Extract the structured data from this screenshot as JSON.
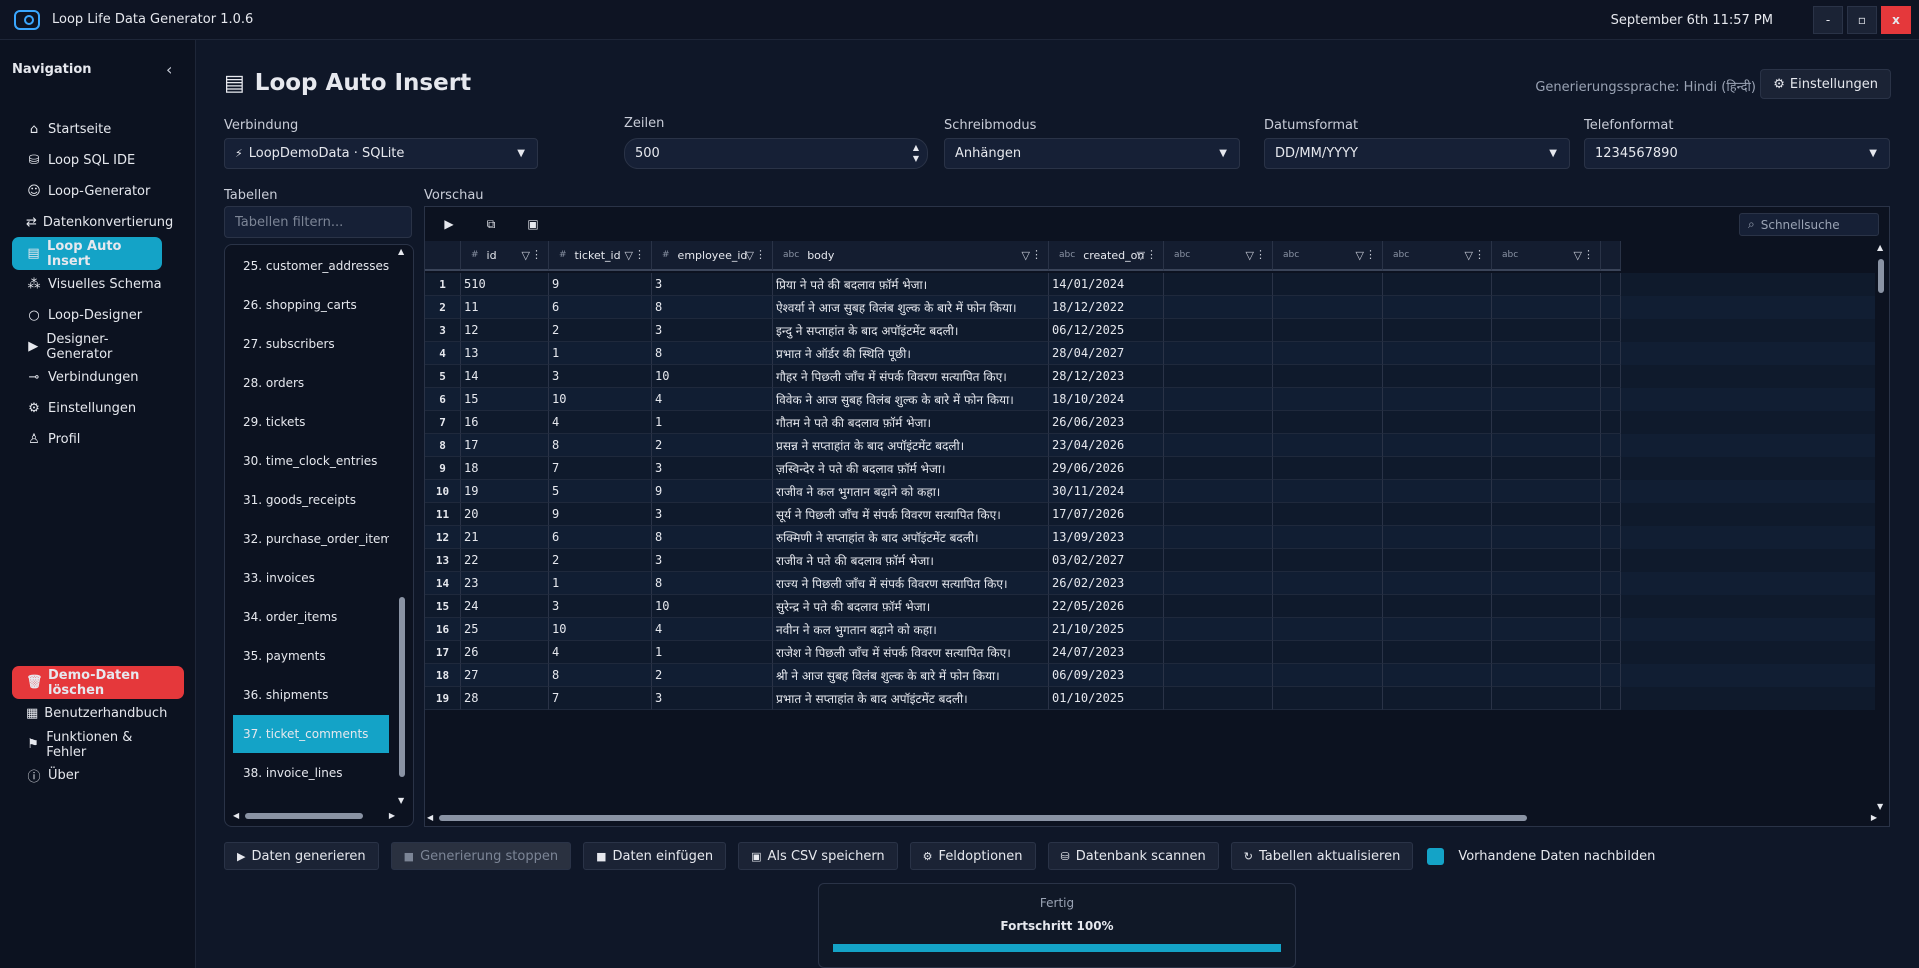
{
  "app": {
    "title": "Loop Life Data Generator 1.0.6",
    "datetime": "September 6th 11:57 PM"
  },
  "window": {
    "minimize": "-",
    "maximize": "▫",
    "close": "x"
  },
  "sidebar": {
    "header": "Navigation",
    "collapse": "‹",
    "items": [
      {
        "label": "Startseite",
        "icon": "home-icon",
        "glyph": "⌂"
      },
      {
        "label": "Loop SQL IDE",
        "icon": "database-icon",
        "glyph": "⛁"
      },
      {
        "label": "Loop-Generator",
        "icon": "users-icon",
        "glyph": "☺"
      },
      {
        "label": "Datenkonvertierung",
        "icon": "convert-icon",
        "glyph": "⇄"
      },
      {
        "label": "Loop Auto Insert",
        "icon": "table-icon",
        "glyph": "▤",
        "active": true
      },
      {
        "label": "Visuelles Schema",
        "icon": "schema-icon",
        "glyph": "⁂"
      },
      {
        "label": "Loop-Designer",
        "icon": "circle-icon",
        "glyph": "○"
      },
      {
        "label": "Designer-Generator",
        "icon": "play-icon",
        "glyph": "▶"
      },
      {
        "label": "Verbindungen",
        "icon": "plug-icon",
        "glyph": "⊸"
      },
      {
        "label": "Einstellungen",
        "icon": "gear-icon",
        "glyph": "⚙"
      },
      {
        "label": "Profil",
        "icon": "user-icon",
        "glyph": "♙"
      }
    ],
    "bottom": [
      {
        "label": "Demo-Daten löschen",
        "icon": "trash-icon",
        "glyph": "🗑",
        "danger": true
      },
      {
        "label": "Benutzerhandbuch",
        "icon": "book-icon",
        "glyph": "▦"
      },
      {
        "label": "Funktionen & Fehler",
        "icon": "flag-icon",
        "glyph": "⚑"
      },
      {
        "label": "Über",
        "icon": "info-icon",
        "glyph": "ⓘ"
      }
    ]
  },
  "page": {
    "title": "Loop Auto Insert",
    "title_icon": "table-icon",
    "lang_label": "Generierungssprache: Hindi (हिन्दी)",
    "settings_button": "Einstellungen"
  },
  "form": {
    "connection": {
      "label": "Verbindung",
      "value": "LoopDemoData · SQLite"
    },
    "rows": {
      "label": "Zeilen",
      "value": "500"
    },
    "write_mode": {
      "label": "Schreibmodus",
      "value": "Anhängen"
    },
    "date_format": {
      "label": "Datumsformat",
      "value": "DD/MM/YYYY"
    },
    "phone_format": {
      "label": "Telefonformat",
      "value": "1234567890"
    }
  },
  "tables": {
    "label": "Tabellen",
    "filter_placeholder": "Tabellen filtern...",
    "items": [
      "25. customer_addresses",
      "26. shopping_carts",
      "27. subscribers",
      "28. orders",
      "29. tickets",
      "30. time_clock_entries",
      "31. goods_receipts",
      "32. purchase_order_items",
      "33. invoices",
      "34. order_items",
      "35. payments",
      "36. shipments",
      "37. ticket_comments",
      "38. invoice_lines"
    ],
    "selected": "37. ticket_comments"
  },
  "preview": {
    "label": "Vorschau",
    "search_placeholder": "Schnellsuche",
    "columns": [
      {
        "type": "#",
        "name": "id"
      },
      {
        "type": "#",
        "name": "ticket_id"
      },
      {
        "type": "#",
        "name": "employee_id"
      },
      {
        "type": "abc",
        "name": "body"
      },
      {
        "type": "abc",
        "name": "created_on"
      },
      {
        "type": "abc",
        "name": ""
      },
      {
        "type": "abc",
        "name": ""
      },
      {
        "type": "abc",
        "name": ""
      },
      {
        "type": "abc",
        "name": ""
      }
    ],
    "rows": [
      [
        "1",
        "510",
        "9",
        "3",
        "प्रिया ने पते की बदलाव फ़ॉर्म भेजा।",
        "14/01/2024"
      ],
      [
        "2",
        "11",
        "6",
        "8",
        "ऐश्वर्या ने आज सुबह विलंब शुल्क के बारे में फोन किया।",
        "18/12/2022"
      ],
      [
        "3",
        "12",
        "2",
        "3",
        "इन्दु ने सप्ताहांत के बाद अपॉइंटमेंट बदली।",
        "06/12/2025"
      ],
      [
        "4",
        "13",
        "1",
        "8",
        "प्रभात ने ऑर्डर की स्थिति पूछी।",
        "28/04/2027"
      ],
      [
        "5",
        "14",
        "3",
        "10",
        "गौहर ने पिछली जाँच में संपर्क विवरण सत्यापित किए।",
        "28/12/2023"
      ],
      [
        "6",
        "15",
        "10",
        "4",
        "विवेक ने आज सुबह विलंब शुल्क के बारे में फोन किया।",
        "18/10/2024"
      ],
      [
        "7",
        "16",
        "4",
        "1",
        "गौतम ने पते की बदलाव फ़ॉर्म भेजा।",
        "26/06/2023"
      ],
      [
        "8",
        "17",
        "8",
        "2",
        "प्रसन्न ने सप्ताहांत के बाद अपॉइंटमेंट बदली।",
        "23/04/2026"
      ],
      [
        "9",
        "18",
        "7",
        "3",
        "ज़स्विन्देर ने पते की बदलाव फ़ॉर्म भेजा।",
        "29/06/2026"
      ],
      [
        "10",
        "19",
        "5",
        "9",
        "राजीव ने कल भुगतान बढ़ाने को कहा।",
        "30/11/2024"
      ],
      [
        "11",
        "20",
        "9",
        "3",
        "सूर्य ने पिछली जाँच में संपर्क विवरण सत्यापित किए।",
        "17/07/2026"
      ],
      [
        "12",
        "21",
        "6",
        "8",
        "रुक्मिणी ने सप्ताहांत के बाद अपॉइंटमेंट बदली।",
        "13/09/2023"
      ],
      [
        "13",
        "22",
        "2",
        "3",
        "राजीव ने पते की बदलाव फ़ॉर्म भेजा।",
        "03/02/2027"
      ],
      [
        "14",
        "23",
        "1",
        "8",
        "राज्य ने पिछली जाँच में संपर्क विवरण सत्यापित किए।",
        "26/02/2023"
      ],
      [
        "15",
        "24",
        "3",
        "10",
        "सुरेन्द्र ने पते की बदलाव फ़ॉर्म भेजा।",
        "22/05/2026"
      ],
      [
        "16",
        "25",
        "10",
        "4",
        "नवीन ने कल भुगतान बढ़ाने को कहा।",
        "21/10/2025"
      ],
      [
        "17",
        "26",
        "4",
        "1",
        "राजेश ने पिछली जाँच में संपर्क विवरण सत्यापित किए।",
        "24/07/2023"
      ],
      [
        "18",
        "27",
        "8",
        "2",
        "श्री ने आज सुबह विलंब शुल्क के बारे में फोन किया।",
        "06/09/2023"
      ],
      [
        "19",
        "28",
        "7",
        "3",
        "प्रभात ने सप्ताहांत के बाद अपॉइंटमेंट बदली।",
        "01/10/2025"
      ]
    ]
  },
  "actions": {
    "generate": "Daten generieren",
    "stop": "Generierung stoppen",
    "insert": "Daten einfügen",
    "save_csv": "Als CSV speichern",
    "field_options": "Feldoptionen",
    "scan_db": "Datenbank scannen",
    "refresh_tables": "Tabellen aktualisieren",
    "replicate_label": "Vorhandene Daten nachbilden",
    "replicate_checked": true
  },
  "progress": {
    "status": "Fertig",
    "text": "Fortschritt 100%",
    "value": 1.0
  },
  "colors": {
    "accent": "#14a3c7",
    "danger": "#e5383b",
    "background": "#0f1728"
  }
}
